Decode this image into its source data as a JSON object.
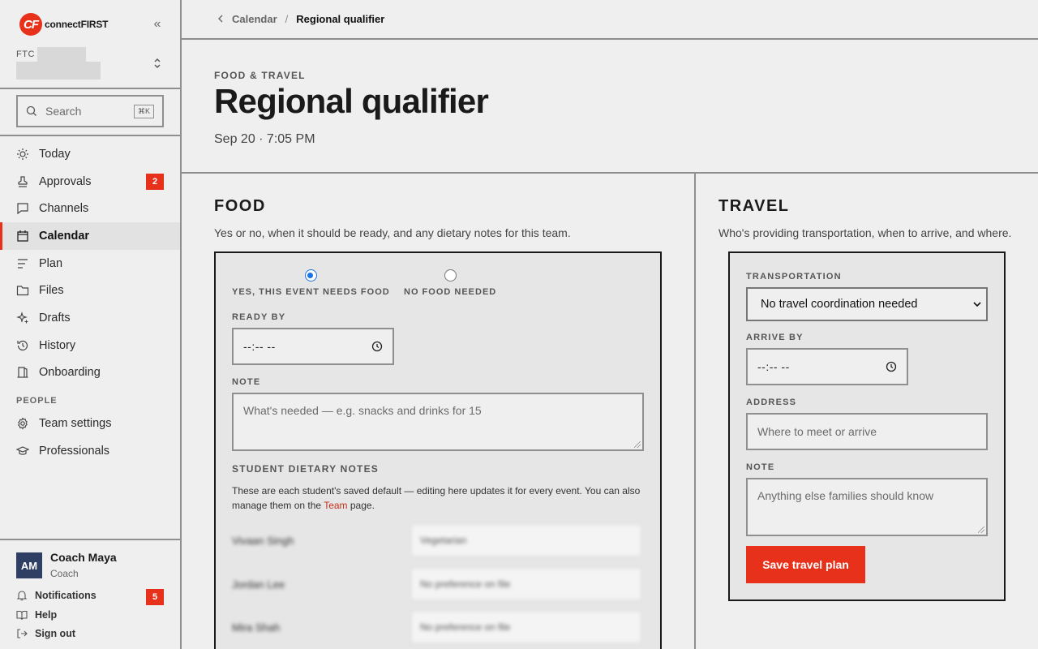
{
  "brand": {
    "name": "connectFIRST",
    "mark": "CF",
    "accent": "#e8311a"
  },
  "org": {
    "label": "FTC"
  },
  "search": {
    "placeholder": "Search",
    "shortcut": "⌘K"
  },
  "nav": {
    "items": [
      {
        "label": "Today",
        "icon": "sun-icon"
      },
      {
        "label": "Approvals",
        "icon": "stamp-icon",
        "badge": "2"
      },
      {
        "label": "Channels",
        "icon": "chat-icon"
      },
      {
        "label": "Calendar",
        "icon": "calendar-icon",
        "active": true
      },
      {
        "label": "Plan",
        "icon": "list-icon"
      },
      {
        "label": "Files",
        "icon": "folder-icon"
      },
      {
        "label": "Drafts",
        "icon": "sparkle-icon"
      },
      {
        "label": "History",
        "icon": "history-icon"
      },
      {
        "label": "Onboarding",
        "icon": "door-icon"
      }
    ],
    "people_label": "PEOPLE",
    "people_items": [
      {
        "label": "Team settings",
        "icon": "gear-icon"
      },
      {
        "label": "Professionals",
        "icon": "graduation-cap-icon"
      }
    ]
  },
  "user": {
    "initials": "AM",
    "name": "Coach Maya",
    "role": "Coach",
    "notifications_label": "Notifications",
    "notifications_count": "5",
    "help_label": "Help",
    "signout_label": "Sign out"
  },
  "breadcrumb": {
    "parent": "Calendar",
    "separator": "/",
    "current": "Regional qualifier"
  },
  "event": {
    "eyebrow": "FOOD & TRAVEL",
    "title": "Regional qualifier",
    "datetime": "Sep 20 · 7:05 PM"
  },
  "food": {
    "heading": "FOOD",
    "description": "Yes or no, when it should be ready, and any dietary notes for this team.",
    "option_yes": "YES, THIS EVENT NEEDS FOOD",
    "option_no": "NO FOOD NEEDED",
    "selected": "yes",
    "ready_by_label": "READY BY",
    "ready_by_value": "--:-- --",
    "note_label": "NOTE",
    "note_placeholder": "What's needed — e.g. snacks and drinks for 15",
    "dietary_label": "STUDENT DIETARY NOTES",
    "dietary_help_prefix": "These are each student's saved default — editing here updates it for every event. You can also manage them on the ",
    "dietary_help_link": "Team",
    "dietary_help_suffix": " page.",
    "students": [
      {
        "name": "Vivaan Singh",
        "value": "Vegetarian"
      },
      {
        "name": "Jordan Lee",
        "value": "No preference on file"
      },
      {
        "name": "Mira Shah",
        "value": "No preference on file"
      }
    ]
  },
  "travel": {
    "heading": "TRAVEL",
    "description": "Who's providing transportation, when to arrive, and where.",
    "transport_label": "TRANSPORTATION",
    "transport_value": "No travel coordination needed",
    "arrive_label": "ARRIVE BY",
    "arrive_value": "--:-- --",
    "address_label": "ADDRESS",
    "address_placeholder": "Where to meet or arrive",
    "note_label": "NOTE",
    "note_placeholder": "Anything else families should know",
    "save_label": "Save travel plan"
  }
}
